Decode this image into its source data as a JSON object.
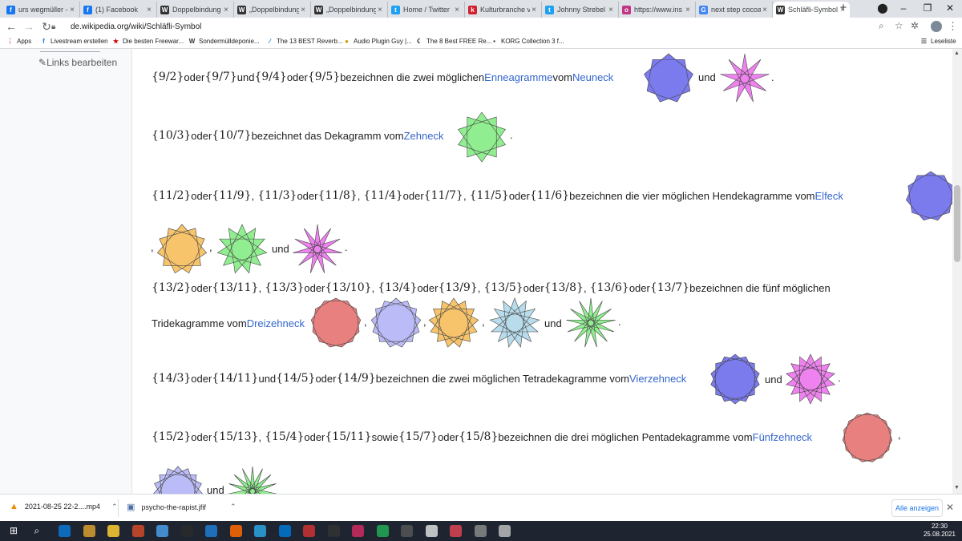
{
  "browser": {
    "tabs": [
      {
        "label": "urs wegmüller -",
        "icon": "facebook-icon",
        "color": "#1877f2",
        "glyph": "f"
      },
      {
        "label": "(1) Facebook",
        "icon": "facebook-icon",
        "color": "#1877f2",
        "glyph": "f"
      },
      {
        "label": "Doppelbindung",
        "icon": "wikipedia-icon",
        "color": "#333",
        "glyph": "W"
      },
      {
        "label": "„Doppelbindung",
        "icon": "wikipedia-icon",
        "color": "#333",
        "glyph": "W"
      },
      {
        "label": "„Doppelbindung",
        "icon": "wikipedia-icon",
        "color": "#333",
        "glyph": "W"
      },
      {
        "label": "Home / Twitter",
        "icon": "twitter-icon",
        "color": "#1da1f2",
        "glyph": "t"
      },
      {
        "label": "Kulturbranche v",
        "icon": "kulturbranche-icon",
        "color": "#d32030",
        "glyph": "k"
      },
      {
        "label": "Johnny Strebel",
        "icon": "twitter-icon",
        "color": "#1da1f2",
        "glyph": "t"
      },
      {
        "label": "https://www.ins",
        "icon": "instagram-icon",
        "color": "#c13584",
        "glyph": "o"
      },
      {
        "label": "next step cocoa",
        "icon": "google-icon",
        "color": "#4285f4",
        "glyph": "G"
      },
      {
        "label": "Schläfli-Symbol",
        "icon": "wikipedia-icon",
        "color": "#333",
        "glyph": "W"
      }
    ],
    "url": "de.wikipedia.org/wiki/Schläfli-Symbol",
    "bookmarks": [
      {
        "label": "Apps",
        "icon": "apps-icon",
        "glyph": "⋮",
        "color": "#d44"
      },
      {
        "label": "Livestream erstellen",
        "icon": "facebook-icon",
        "glyph": "f",
        "color": "#1877f2"
      },
      {
        "label": "Die besten Freewar...",
        "icon": "star-icon",
        "glyph": "★",
        "color": "#c00"
      },
      {
        "label": "Sondermülldeponie...",
        "icon": "wikipedia-icon",
        "glyph": "W",
        "color": "#333"
      },
      {
        "label": "The 13 BEST Reverb...",
        "icon": "plugin-icon",
        "glyph": "∕",
        "color": "#0077cc"
      },
      {
        "label": "Audio Plugin Guy |...",
        "icon": "bee-icon",
        "glyph": "●",
        "color": "#c90"
      },
      {
        "label": "The 8 Best FREE Re...",
        "icon": "moon-icon",
        "glyph": "☾",
        "color": "#222"
      },
      {
        "label": "KORG Collection 3 f...",
        "icon": "korg-icon",
        "glyph": "▪",
        "color": "#222"
      }
    ],
    "reading_list": "Leseliste"
  },
  "sidebar": {
    "edit_links": "Links bearbeiten"
  },
  "article": {
    "l1": {
      "m1": "{9/2}",
      "t1": " oder ",
      "m2": "{9/7}",
      "t2": " und ",
      "m3": "{9/4}",
      "t3": "oder ",
      "m4": "{9/5}",
      "t4": " bezeichnen die zwei möglichen ",
      "link1": "Enneagramme",
      "t5": " vom ",
      "link2": "Neuneck",
      "t6": "und",
      "t7": "."
    },
    "l2": {
      "m1": "{10/3}",
      "t1": " oder ",
      "m2": "{10/7}",
      "t2": " bezeichnet das Dekagramm vom ",
      "link1": "Zehneck",
      "t3": "."
    },
    "l3": {
      "m1": "{11/2}",
      "t1": " oder ",
      "m2": "{11/9}",
      "c1": ",",
      "m3": "{11/3}",
      "t2": " oder ",
      "m4": "{11/8}",
      "c2": ",",
      "m5": "{11/4}",
      "t3": " oder ",
      "m6": "{11/7}",
      "c3": ",",
      "m7": "{11/5}",
      "t4": " oder ",
      "m8": "{11/6}",
      "t5": " bezeichnen die vier möglichen Hendekagramme vom ",
      "link1": "Elfeck"
    },
    "l4": {
      "c1": ",",
      "c2": ",",
      "t1": "und",
      "t2": "."
    },
    "l5": {
      "m1": "{13/2}",
      "t1": " oder ",
      "m2": "{13/11}",
      "c1": ",",
      "m3": "{13/3}",
      "t2": " oder ",
      "m4": "{13/10}",
      "c2": ",",
      "m5": "{13/4}",
      "t3": " oder ",
      "m6": "{13/9}",
      "c3": ",",
      "m7": "{13/5}",
      "t4": " oder ",
      "m8": "{13/8}",
      "c4": ",",
      "m9": "{13/6}",
      "t5": " oder ",
      "m10": "{13/7}",
      "t6": " bezeichnen die fünf möglichen"
    },
    "l6": {
      "t1": "Tridekagramme vom ",
      "link1": "Dreizehneck",
      "c1": ",",
      "c2": ",",
      "c3": ",",
      "t2": "und",
      "t3": "."
    },
    "l7": {
      "m1": "{14/3}",
      "t1": " oder ",
      "m2": "{14/11}",
      "t2": " und ",
      "m3": "{14/5}",
      "t3": " oder ",
      "m4": "{14/9}",
      "t4": " bezeichnen die zwei möglichen Tetradekagramme vom ",
      "link1": "Vierzehneck",
      "t5": "und",
      "t6": "."
    },
    "l8": {
      "m1": "{15/2}",
      "t1": " oder ",
      "m2": "{15/13}",
      "c1": ",",
      "m3": "{15/4}",
      "t2": " oder ",
      "m4": "{15/11}",
      "t3": " sowie ",
      "m5": "{15/7}",
      "t4": " oder ",
      "m6": "{15/8}",
      "t5": " bezeichnen die drei möglichen Pentadekagramme vom ",
      "link1": "Fünfzehneck",
      "c1b": ","
    },
    "l9": {
      "t1": "und"
    }
  },
  "downloads": [
    {
      "name": "2021-08-25 22-2....mp4",
      "icon": "vlc-icon"
    },
    {
      "name": "psycho-the-rapist.jfif",
      "icon": "image-file-icon"
    }
  ],
  "downloads_show_all": "Alle anzeigen",
  "taskbar": {
    "time": "22:30",
    "date": "25.08.2021"
  },
  "star_colors": {
    "blue": "#7b7bee",
    "magenta": "#ee82ee",
    "green": "#90ee90",
    "orange": "#f7c46c",
    "red": "#e88080",
    "lavender": "#bbbbf7",
    "lightblue": "#b8dcec",
    "stroke": "#444"
  }
}
